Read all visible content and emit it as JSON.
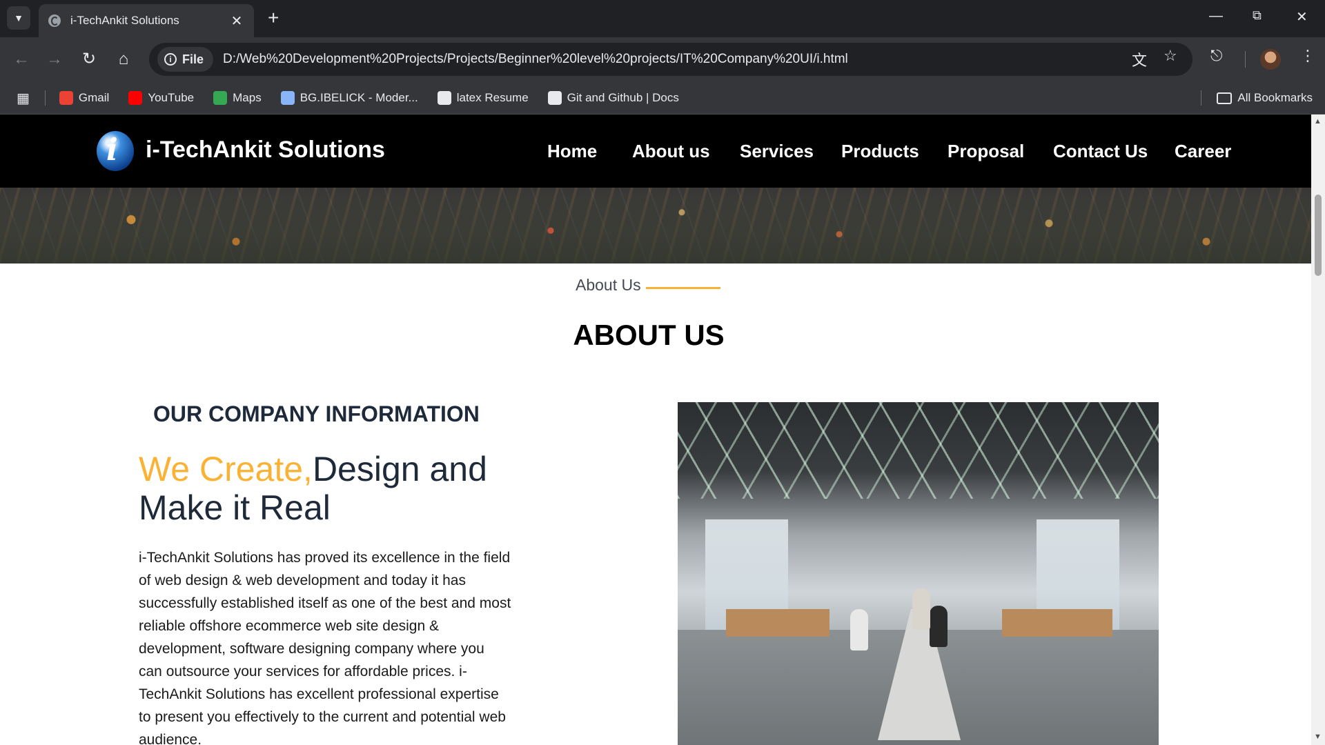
{
  "browser": {
    "tab_title": "i-TechAnkit Solutions",
    "site_info_label": "File",
    "url": "D:/Web%20Development%20Projects/Projects/Beginner%20level%20projects/IT%20Company%20UI/i.html",
    "bookmarks": [
      {
        "label": "Gmail",
        "color": "#ea4335"
      },
      {
        "label": "YouTube",
        "color": "#ff0000"
      },
      {
        "label": "Maps",
        "color": "#34a853"
      },
      {
        "label": "BG.IBELICK - Moder...",
        "color": "#8ab4f8"
      },
      {
        "label": "latex Resume",
        "color": "#e8eaed"
      },
      {
        "label": "Git and Github | Docs",
        "color": "#e8eaed"
      }
    ],
    "all_bookmarks_label": "All Bookmarks"
  },
  "site": {
    "brand": "i-TechAnkit Solutions",
    "logo_letter": "i",
    "nav": [
      "Home",
      "About us",
      "Services",
      "Products",
      "Proposal",
      "Contact Us",
      "Career"
    ],
    "accent_color": "#f9b233"
  },
  "about": {
    "eyebrow": "About Us",
    "title": "ABOUT US",
    "company_info_heading": "OUR COMPANY INFORMATION",
    "tagline_accent": "We Create,",
    "tagline_rest": "Design and Make it Real",
    "description": "i-TechAnkit Solutions has proved its excellence in the field of web design & web development and today it has successfully established itself as one of the best and most reliable offshore ecommerce web site design & development, software designing company where you can outsource your services for affordable prices. i-TechAnkit Solutions has excellent professional expertise to present you effectively to the current and potential web audience."
  }
}
